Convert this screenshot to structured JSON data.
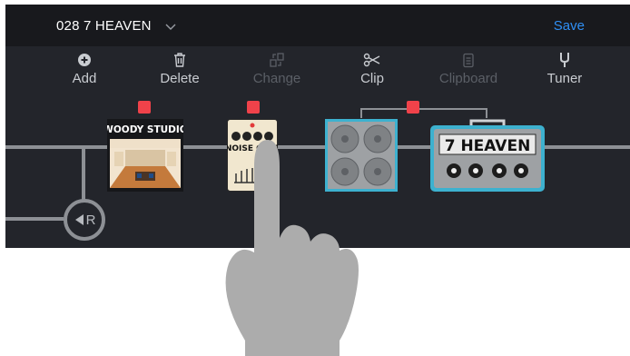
{
  "header": {
    "preset_name": "028 7 HEAVEN",
    "save_label": "Save"
  },
  "toolbar": {
    "items": [
      {
        "label": "Add",
        "icon": "add-icon"
      },
      {
        "label": "Delete",
        "icon": "trash-icon"
      },
      {
        "label": "Change",
        "icon": "swap-icon"
      },
      {
        "label": "Clip",
        "icon": "scissors-icon"
      },
      {
        "label": "Clipboard",
        "icon": "clipboard-icon"
      },
      {
        "label": "Tuner",
        "icon": "tuning-fork-icon"
      }
    ]
  },
  "chain": {
    "blocks": [
      {
        "name": "WOODY STUDIO",
        "type": "room reverb"
      },
      {
        "name": "NOISE GATE",
        "type": "stompbox"
      },
      {
        "name": "",
        "type": "speaker cabinet"
      },
      {
        "name": "7 HEAVEN",
        "type": "amplifier"
      }
    ],
    "return_label": "R"
  },
  "colors": {
    "accent": "#2f8ff5",
    "marker": "#f0424a",
    "cable": "#8d9095",
    "amp": "#3db1cf"
  }
}
